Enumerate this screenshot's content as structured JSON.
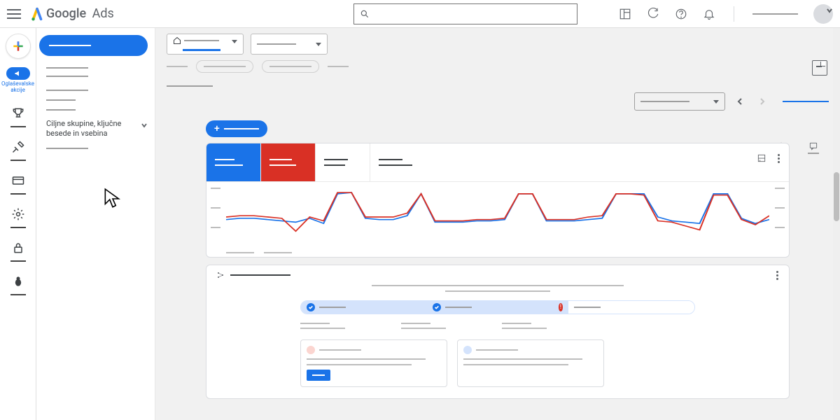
{
  "header": {
    "logo_g": "Google",
    "logo_ads": "Ads"
  },
  "rail": {
    "active_label": "Oglaševalske akcije"
  },
  "sidebar": {
    "expandable_text": "Ciljne skupine, ključne besede in vsebina"
  },
  "colors": {
    "accent": "#1a73e8",
    "danger": "#d93025"
  },
  "chart_data": {
    "type": "line",
    "x": [
      0,
      1,
      2,
      3,
      4,
      5,
      6,
      7,
      8,
      9,
      10,
      11,
      12,
      13,
      14,
      15,
      16,
      17,
      18,
      19,
      20,
      21,
      22,
      23,
      24,
      25,
      26,
      27,
      28,
      29,
      30,
      31,
      32,
      33,
      34,
      35,
      36,
      37,
      38,
      39
    ],
    "series": [
      {
        "name": "blue",
        "color": "#1a73e8",
        "values": [
          46,
          48,
          48,
          46,
          44,
          42,
          48,
          40,
          86,
          88,
          48,
          46,
          46,
          52,
          86,
          42,
          42,
          42,
          44,
          44,
          46,
          86,
          86,
          44,
          44,
          44,
          46,
          48,
          86,
          86,
          86,
          50,
          44,
          42,
          40,
          86,
          86,
          48,
          40,
          46
        ]
      },
      {
        "name": "red",
        "color": "#d93025",
        "values": [
          50,
          52,
          52,
          50,
          48,
          28,
          50,
          44,
          88,
          88,
          50,
          50,
          50,
          56,
          86,
          44,
          44,
          44,
          46,
          46,
          48,
          86,
          86,
          46,
          46,
          46,
          50,
          52,
          86,
          86,
          84,
          44,
          42,
          36,
          30,
          84,
          84,
          46,
          38,
          52
        ]
      }
    ],
    "ylim": [
      0,
      100
    ],
    "title": "",
    "xlabel": "",
    "ylabel": ""
  },
  "optimization": {
    "steps": [
      {
        "status": "done"
      },
      {
        "status": "done"
      },
      {
        "status": "error"
      },
      {
        "status": "pending"
      }
    ]
  }
}
